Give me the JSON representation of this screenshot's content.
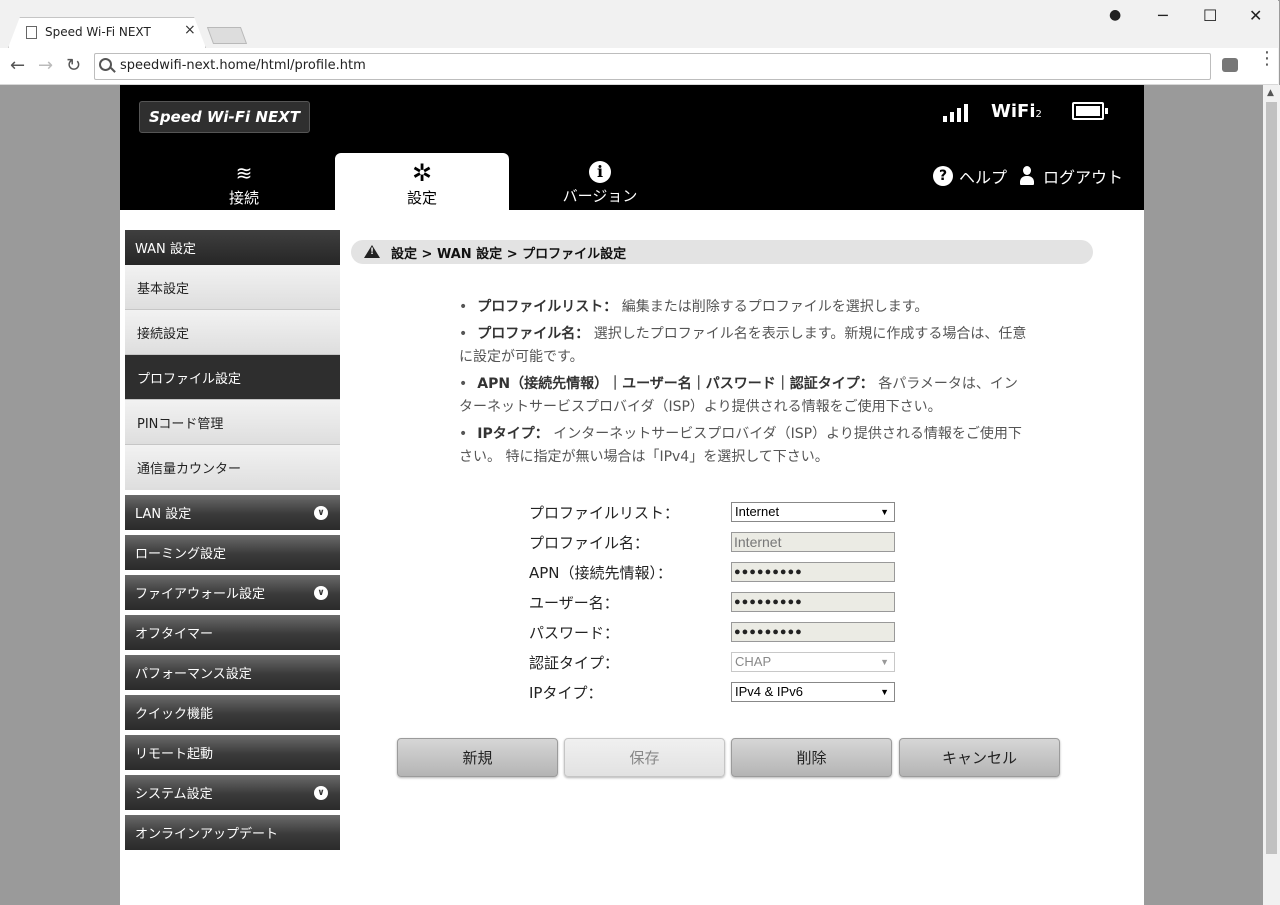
{
  "browser": {
    "tab_title": "Speed Wi-Fi NEXT",
    "tab_close": "×",
    "url": "speedwifi-next.home/html/profile.htm",
    "win_min": "─",
    "win_max": "☐",
    "win_close": "✕",
    "back": "←",
    "forward": "→",
    "reload": "↻",
    "menu": "⋮"
  },
  "header": {
    "logo_text": "Speed Wi-Fi NEXT",
    "wifi_label": "WiFi",
    "wifi_sub": "2",
    "tabs": [
      {
        "label": "接続",
        "icon": "wifi-icon"
      },
      {
        "label": "設定",
        "icon": "gear-icon",
        "active": true
      },
      {
        "label": "バージョン",
        "icon": "info-icon"
      }
    ],
    "help_label": "ヘルプ",
    "help_icon_glyph": "?",
    "logout_label": "ログアウト"
  },
  "sidebar": {
    "items": [
      {
        "label": "WAN 設定",
        "type": "head"
      },
      {
        "label": "基本設定",
        "type": "sub"
      },
      {
        "label": "接続設定",
        "type": "sub"
      },
      {
        "label": "プロファイル設定",
        "type": "sub",
        "active": true
      },
      {
        "label": "PINコード管理",
        "type": "sub"
      },
      {
        "label": "通信量カウンター",
        "type": "sub"
      },
      {
        "label": "LAN 設定",
        "type": "head",
        "chevron": true
      },
      {
        "label": "ローミング設定",
        "type": "head"
      },
      {
        "label": "ファイアウォール設定",
        "type": "head",
        "chevron": true
      },
      {
        "label": "オフタイマー",
        "type": "head"
      },
      {
        "label": "パフォーマンス設定",
        "type": "head"
      },
      {
        "label": "クイック機能",
        "type": "head"
      },
      {
        "label": "リモート起動",
        "type": "head"
      },
      {
        "label": "システム設定",
        "type": "head",
        "chevron": true
      },
      {
        "label": "オンラインアップデート",
        "type": "head"
      }
    ]
  },
  "breadcrumb": "設定 > WAN 設定 > プロファイル設定",
  "help_text": [
    {
      "term": "プロファイルリスト：",
      "desc": "編集または削除するプロファイルを選択します。"
    },
    {
      "term": "プロファイル名：",
      "desc": "選択したプロファイル名を表示します。新規に作成する場合は、任意に設定が可能です。"
    },
    {
      "term": "APN（接続先情報）｜ユーザー名｜パスワード｜認証タイプ：",
      "desc": "各パラメータは、インターネットサービスプロバイダ（ISP）より提供される情報をご使用下さい。"
    },
    {
      "term": "IPタイプ：",
      "desc": "インターネットサービスプロバイダ（ISP）より提供される情報をご使用下さい。 特に指定が無い場合は「IPv4」を選択して下さい。"
    }
  ],
  "form": {
    "profile_list_label": "プロファイルリスト：",
    "profile_list_value": "Internet",
    "profile_name_label": "プロファイル名：",
    "profile_name_value": "Internet",
    "apn_label": "APN（接続先情報）：",
    "apn_value": "●●●●●●●●●",
    "user_label": "ユーザー名：",
    "user_value": "●●●●●●●●●",
    "password_label": "パスワード：",
    "password_value": "●●●●●●●●●",
    "auth_label": "認証タイプ：",
    "auth_value": "CHAP",
    "ip_label": "IPタイプ：",
    "ip_value": "IPv4 & IPv6",
    "arrow": "▼"
  },
  "buttons": {
    "new": "新規",
    "save": "保存",
    "delete": "削除",
    "cancel": "キャンセル"
  }
}
